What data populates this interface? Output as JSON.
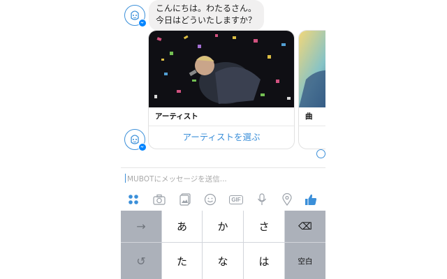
{
  "chat": {
    "greeting_line1": "こんにちは。わたるさん。",
    "greeting_line2": "今日はどういたしますか？"
  },
  "cards": [
    {
      "title": "アーティスト",
      "action": "アーティストを選ぶ"
    },
    {
      "title": "曲"
    }
  ],
  "composer": {
    "placeholder": "MUBOTにメッセージを送信..."
  },
  "toolbar": {
    "icons": [
      "apps-icon",
      "camera-icon",
      "photos-icon",
      "emoji-icon",
      "gif-icon",
      "microphone-icon",
      "location-icon",
      "thumbs-up-icon"
    ],
    "gif_label": "GIF",
    "accent": "#3b8fd9"
  },
  "keyboard": {
    "row1": {
      "left": "→",
      "k1": "あ",
      "k2": "か",
      "k3": "さ",
      "right": "⌫"
    },
    "row2": {
      "left": "↺",
      "k1": "た",
      "k2": "な",
      "k3": "は",
      "right": "空白"
    }
  }
}
